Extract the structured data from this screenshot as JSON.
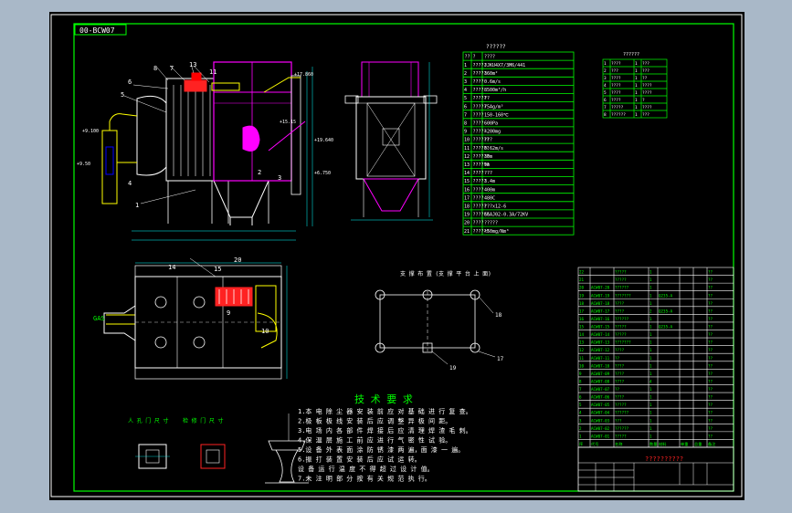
{
  "drawing_code": "00-BCW07",
  "spec_table_title": "??????",
  "spec_table_head": [
    "??",
    "?",
    "????"
  ],
  "spec_rows": [
    {
      "no": "1",
      "name": "?????",
      "value": "JJKU4X7/3M6/441"
    },
    {
      "no": "2",
      "name": "?????",
      "value": "360m²"
    },
    {
      "no": "3",
      "name": "????",
      "value": "0.6m/s"
    },
    {
      "no": "4",
      "name": "????",
      "value": "8500m³/h"
    },
    {
      "no": "5",
      "name": "?????",
      "value": "??"
    },
    {
      "no": "6",
      "name": "?????",
      "value": "75Ag/m³"
    },
    {
      "no": "7",
      "name": "????",
      "value": "150-160℃"
    },
    {
      "no": "8",
      "name": "????",
      "value": "600Pa"
    },
    {
      "no": "9",
      "name": "?????",
      "value": "<200mg"
    },
    {
      "no": "10",
      "name": "??????",
      "value": "???"
    },
    {
      "no": "11",
      "name": "??????",
      "value": "0.62m/s"
    },
    {
      "no": "12",
      "name": "??????",
      "value": "30m"
    },
    {
      "no": "13",
      "name": "??????",
      "value": "9m"
    },
    {
      "no": "14",
      "name": "????",
      "value": "???"
    },
    {
      "no": "15",
      "name": "?????",
      "value": "3.4m"
    },
    {
      "no": "16",
      "name": "????",
      "value": "400m"
    },
    {
      "no": "17",
      "name": "????",
      "value": "480C"
    },
    {
      "no": "18",
      "name": "?????",
      "value": "???x12-6"
    },
    {
      "no": "19",
      "name": "??????",
      "value": "GGAJ02-0.3A/72KV"
    },
    {
      "no": "20",
      "name": "????",
      "value": "?????"
    },
    {
      "no": "21",
      "name": "??????",
      "value": "<50mg/Nm³"
    }
  ],
  "small_table_title": "??????",
  "small_rows": [
    [
      "1",
      "????",
      "1",
      "???"
    ],
    [
      "2",
      "???",
      "1",
      "???"
    ],
    [
      "3",
      "????",
      "1",
      "??"
    ],
    [
      "4",
      "????",
      "1",
      "????"
    ],
    [
      "5",
      "????",
      "1",
      "????"
    ],
    [
      "6",
      "????",
      "1",
      "?"
    ],
    [
      "7",
      "?????",
      "1",
      "????"
    ],
    [
      "8",
      "??????",
      "1",
      "???"
    ]
  ],
  "support_plan_title": "支 撑 布 置 (支 撑 平 台 上 面)",
  "support_labels": [
    "18",
    "17",
    "19"
  ],
  "plan_labels": [
    "14",
    "15",
    "20",
    "9",
    "10"
  ],
  "gas_label": "GAS",
  "elev_labels": [
    "7",
    "8",
    "13",
    "11",
    "6",
    "5",
    "4",
    "2",
    "1",
    "3"
  ],
  "dim_labels": [
    "+17.860",
    "+15.15",
    "+9.100",
    "+19.640",
    "+6.750",
    "+9.50"
  ],
  "notes_title": "技 术 要 求",
  "notes": [
    "1.本 电 除 尘 器 安 装 前 应 对 基 础 进 行 复 查。",
    "2.极 板 极 线 安 装 后 应 调 整 异 极 间 距。",
    "3.电 场 内 各 部 件 焊 接 后 应 清 理 焊 渣 毛 刺。",
    "4.保 温 层 施 工 前 应 进 行 气 密 性 试 验。",
    "5.设 备 外 表 面 涂 防 锈 漆 两 遍，面 漆 一 遍。",
    "6.振 打 装 置 安 装 后 应 试 运 转。",
    "  设 备 运 行 温 度 不 得 超 过 设 计 值。",
    "7.未 注 明 部 分 按 有 关 规 范 执 行。"
  ],
  "detail_titles": [
    "人 孔 门 尺 寸",
    "检 修 门 尺 寸"
  ],
  "bom_header": [
    "序",
    "代号",
    "名称",
    "数量",
    "材料",
    "单重",
    "总重",
    "备注"
  ],
  "bom_rows": [
    [
      "22",
      "",
      "?????",
      "1",
      "",
      "",
      "",
      "??"
    ],
    [
      "21",
      "",
      "?????",
      "1",
      "",
      "",
      "",
      "??"
    ],
    [
      "20",
      "ACW07-20",
      "??????",
      "1",
      "",
      "",
      "",
      "??"
    ],
    [
      "19",
      "ACW07-19",
      "???????",
      "1",
      "Q235-A",
      "",
      "",
      "??"
    ],
    [
      "18",
      "ACW07-18",
      "????",
      "1",
      "",
      "",
      "",
      "??"
    ],
    [
      "17",
      "ACW07-17",
      "????",
      "2",
      "Q235-A",
      "",
      "",
      "??"
    ],
    [
      "16",
      "ACW07-16",
      "??????",
      "1",
      "",
      "",
      "",
      "??"
    ],
    [
      "15",
      "ACW07-15",
      "?????",
      "1",
      "Q235-A",
      "",
      "",
      "??"
    ],
    [
      "14",
      "ACW07-14",
      "?????",
      "1",
      "",
      "",
      "",
      "??"
    ],
    [
      "13",
      "ACW07-13",
      "???????",
      "1",
      "",
      "",
      "",
      "??"
    ],
    [
      "12",
      "ACW07-12",
      "????",
      "1",
      "",
      "",
      "",
      "??"
    ],
    [
      "11",
      "ACW07-11",
      "??",
      "1",
      "",
      "",
      "",
      "??"
    ],
    [
      "10",
      "ACW07-10",
      "????",
      "1",
      "",
      "",
      "",
      "??"
    ],
    [
      "9",
      "ACW07-09",
      "????",
      "1",
      "",
      "",
      "",
      "??"
    ],
    [
      "8",
      "ACW07-08",
      "????",
      "4",
      "",
      "",
      "",
      "??"
    ],
    [
      "7",
      "ACW07-07",
      "??",
      "1",
      "",
      "",
      "",
      "??"
    ],
    [
      "6",
      "ACW07-06",
      "????",
      "1",
      "",
      "",
      "",
      "??"
    ],
    [
      "5",
      "ACW07-05",
      "?????",
      "1",
      "",
      "",
      "",
      "??"
    ],
    [
      "4",
      "ACW07-04",
      "??????",
      "1",
      "",
      "",
      "",
      "??"
    ],
    [
      "3",
      "ACW07-03",
      "???",
      "1",
      "",
      "",
      "",
      "??"
    ],
    [
      "2",
      "ACW07-02",
      "??????",
      "1",
      "",
      "",
      "",
      "??"
    ],
    [
      "1",
      "ACW07-01",
      "?????",
      "1",
      "",
      "",
      "",
      "??"
    ]
  ],
  "title_block_name": "??????????"
}
